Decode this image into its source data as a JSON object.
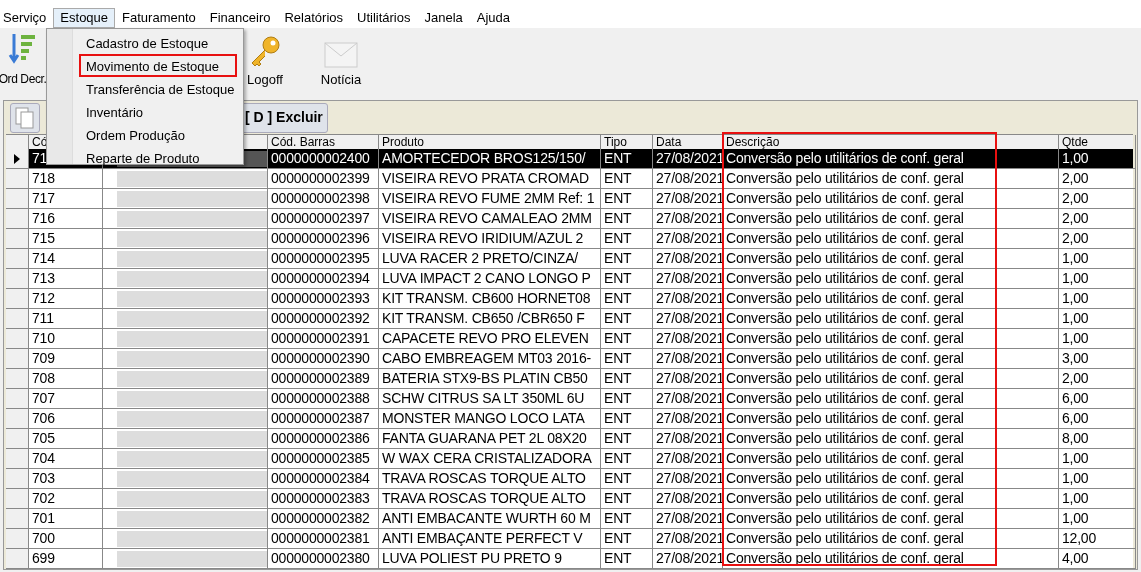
{
  "menubar": [
    {
      "label": "Serviço",
      "selected": false
    },
    {
      "label": "Estoque",
      "selected": true
    },
    {
      "label": "Faturamento",
      "selected": false
    },
    {
      "label": "Financeiro",
      "selected": false
    },
    {
      "label": "Relatórios",
      "selected": false
    },
    {
      "label": "Utilitários",
      "selected": false
    },
    {
      "label": "Janela",
      "selected": false
    },
    {
      "label": "Ajuda",
      "selected": false
    }
  ],
  "dropdown": [
    {
      "label": "Cadastro de Estoque",
      "selected": false
    },
    {
      "label": "Movimento de Estoque",
      "selected": true
    },
    {
      "label": "Transferência de Estoque",
      "selected": false
    },
    {
      "label": "Inventário",
      "selected": false
    },
    {
      "label": "Ordem Produção",
      "selected": false
    },
    {
      "label": "Reparte de Produto",
      "selected": false
    }
  ],
  "toolbar": [
    {
      "kind": "sort",
      "label": "Ord Decr."
    },
    {
      "kind": "key",
      "label": "Logoff"
    },
    {
      "kind": "mail",
      "label": "Notícia"
    }
  ],
  "actions": {
    "delete": "[ D ] Excluir"
  },
  "table": {
    "columns": [
      "Có",
      "Cód. Barras",
      "Produto",
      "Tipo",
      "Data",
      "Descrição",
      "Qtde"
    ],
    "rows": [
      {
        "selected": true,
        "code": "71",
        "barcode": "0000000002400",
        "product": "AMORTECEDOR BROS125/150/",
        "type": "ENT",
        "date": "27/08/2021",
        "description": "Conversão pelo utilitários de conf. geral",
        "qty": "1,00"
      },
      {
        "selected": false,
        "code": "718",
        "barcode": "0000000002399",
        "product": "VISEIRA REVO PRATA CROMAD",
        "type": "ENT",
        "date": "27/08/2021",
        "description": "Conversão pelo utilitários de conf. geral",
        "qty": "2,00"
      },
      {
        "selected": false,
        "code": "717",
        "barcode": "0000000002398",
        "product": "VISEIRA REVO FUME 2MM Ref: 1",
        "type": "ENT",
        "date": "27/08/2021",
        "description": "Conversão pelo utilitários de conf. geral",
        "qty": "2,00"
      },
      {
        "selected": false,
        "code": "716",
        "barcode": "0000000002397",
        "product": "VISEIRA REVO CAMALEAO 2MM",
        "type": "ENT",
        "date": "27/08/2021",
        "description": "Conversão pelo utilitários de conf. geral",
        "qty": "2,00"
      },
      {
        "selected": false,
        "code": "715",
        "barcode": "0000000002396",
        "product": "VISEIRA REVO IRIDIUM/AZUL 2",
        "type": "ENT",
        "date": "27/08/2021",
        "description": "Conversão pelo utilitários de conf. geral",
        "qty": "2,00"
      },
      {
        "selected": false,
        "code": "714",
        "barcode": "0000000002395",
        "product": "LUVA RACER 2 PRETO/CINZA/",
        "type": "ENT",
        "date": "27/08/2021",
        "description": "Conversão pelo utilitários de conf. geral",
        "qty": "1,00"
      },
      {
        "selected": false,
        "code": "713",
        "barcode": "0000000002394",
        "product": "LUVA IMPACT 2 CANO LONGO P",
        "type": "ENT",
        "date": "27/08/2021",
        "description": "Conversão pelo utilitários de conf. geral",
        "qty": "1,00"
      },
      {
        "selected": false,
        "code": "712",
        "barcode": "0000000002393",
        "product": "KIT TRANSM. CB600 HORNET08",
        "type": "ENT",
        "date": "27/08/2021",
        "description": "Conversão pelo utilitários de conf. geral",
        "qty": "1,00"
      },
      {
        "selected": false,
        "code": "711",
        "barcode": "0000000002392",
        "product": "KIT TRANSM. CB650 /CBR650 F",
        "type": "ENT",
        "date": "27/08/2021",
        "description": "Conversão pelo utilitários de conf. geral",
        "qty": "1,00"
      },
      {
        "selected": false,
        "code": "710",
        "barcode": "0000000002391",
        "product": "CAPACETE REVO PRO ELEVEN",
        "type": "ENT",
        "date": "27/08/2021",
        "description": "Conversão pelo utilitários de conf. geral",
        "qty": "1,00"
      },
      {
        "selected": false,
        "code": "709",
        "barcode": "0000000002390",
        "product": "CABO EMBREAGEM MT03 2016-",
        "type": "ENT",
        "date": "27/08/2021",
        "description": "Conversão pelo utilitários de conf. geral",
        "qty": "3,00"
      },
      {
        "selected": false,
        "code": "708",
        "barcode": "0000000002389",
        "product": "BATERIA STX9-BS PLATIN CB50",
        "type": "ENT",
        "date": "27/08/2021",
        "description": "Conversão pelo utilitários de conf. geral",
        "qty": "2,00"
      },
      {
        "selected": false,
        "code": "707",
        "barcode": "0000000002388",
        "product": "SCHW CITRUS SA LT 350ML 6U",
        "type": "ENT",
        "date": "27/08/2021",
        "description": "Conversão pelo utilitários de conf. geral",
        "qty": "6,00"
      },
      {
        "selected": false,
        "code": "706",
        "barcode": "0000000002387",
        "product": "MONSTER MANGO LOCO LATA",
        "type": "ENT",
        "date": "27/08/2021",
        "description": "Conversão pelo utilitários de conf. geral",
        "qty": "6,00"
      },
      {
        "selected": false,
        "code": "705",
        "barcode": "0000000002386",
        "product": "FANTA GUARANA PET 2L 08X20",
        "type": "ENT",
        "date": "27/08/2021",
        "description": "Conversão pelo utilitários de conf. geral",
        "qty": "8,00"
      },
      {
        "selected": false,
        "code": "704",
        "barcode": "0000000002385",
        "product": "W WAX CERA CRISTALIZADORA",
        "type": "ENT",
        "date": "27/08/2021",
        "description": "Conversão pelo utilitários de conf. geral",
        "qty": "1,00"
      },
      {
        "selected": false,
        "code": "703",
        "barcode": "0000000002384",
        "product": "TRAVA ROSCAS TORQUE ALTO",
        "type": "ENT",
        "date": "27/08/2021",
        "description": "Conversão pelo utilitários de conf. geral",
        "qty": "1,00"
      },
      {
        "selected": false,
        "code": "702",
        "barcode": "0000000002383",
        "product": "TRAVA ROSCAS TORQUE ALTO",
        "type": "ENT",
        "date": "27/08/2021",
        "description": "Conversão pelo utilitários de conf. geral",
        "qty": "1,00"
      },
      {
        "selected": false,
        "code": "701",
        "barcode": "0000000002382",
        "product": "ANTI EMBACANTE WURTH 60 M",
        "type": "ENT",
        "date": "27/08/2021",
        "description": "Conversão pelo utilitários de conf. geral",
        "qty": "1,00"
      },
      {
        "selected": false,
        "code": "700",
        "barcode": "0000000002381",
        "product": "ANTI EMBAÇANTE PERFECT V",
        "type": "ENT",
        "date": "27/08/2021",
        "description": "Conversão pelo utilitários de conf. geral",
        "qty": "12,00"
      },
      {
        "selected": false,
        "code": "699",
        "barcode": "0000000002380",
        "product": "LUVA POLIEST PU PRETO 9",
        "type": "ENT",
        "date": "27/08/2021",
        "description": "Conversão pelo utilitários de conf. geral",
        "qty": "4,00"
      }
    ]
  }
}
